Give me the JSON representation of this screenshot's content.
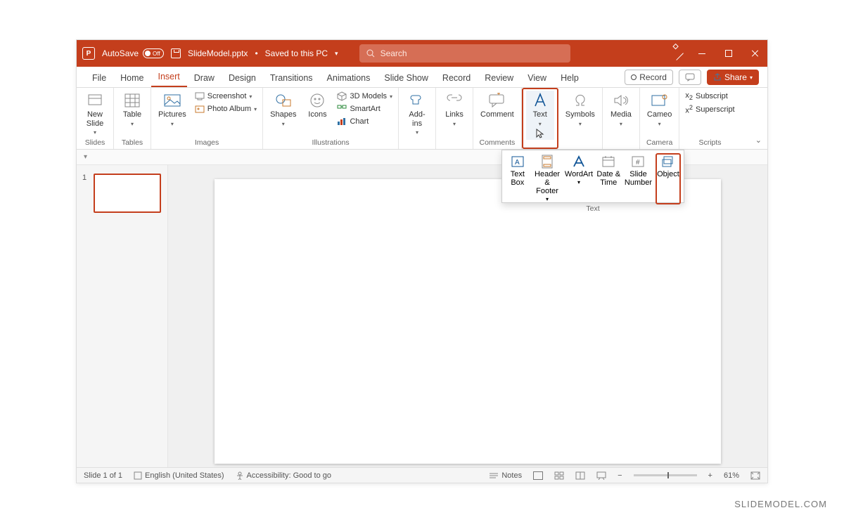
{
  "titlebar": {
    "autosave": "AutoSave",
    "autosave_state": "Off",
    "filename": "SlideModel.pptx",
    "saved_status": "Saved to this PC",
    "search_placeholder": "Search"
  },
  "tabs": {
    "file": "File",
    "home": "Home",
    "insert": "Insert",
    "draw": "Draw",
    "design": "Design",
    "transitions": "Transitions",
    "animations": "Animations",
    "slideshow": "Slide Show",
    "record": "Record",
    "review": "Review",
    "view": "View",
    "help": "Help",
    "record_btn": "Record",
    "share": "Share"
  },
  "ribbon": {
    "groups": {
      "slides": "Slides",
      "tables": "Tables",
      "images": "Images",
      "illustrations": "Illustrations",
      "comments": "Comments",
      "camera": "Camera",
      "scripts": "Scripts"
    },
    "new_slide": "New\nSlide",
    "table": "Table",
    "pictures": "Pictures",
    "screenshot": "Screenshot",
    "photo_album": "Photo Album",
    "shapes": "Shapes",
    "icons": "Icons",
    "models3d": "3D Models",
    "smartart": "SmartArt",
    "chart": "Chart",
    "addins": "Add-\nins",
    "links": "Links",
    "comment": "Comment",
    "text": "Text",
    "symbols": "Symbols",
    "media": "Media",
    "cameo": "Cameo",
    "subscript": "Subscript",
    "superscript": "Superscript"
  },
  "text_popup": {
    "group": "Text",
    "text_box": "Text\nBox",
    "header_footer": "Header\n& Footer",
    "wordart": "WordArt",
    "date_time": "Date &\nTime",
    "slide_number": "Slide\nNumber",
    "object": "Object"
  },
  "thumbs": {
    "n1": "1"
  },
  "statusbar": {
    "slide": "Slide 1 of 1",
    "lang": "English (United States)",
    "access": "Accessibility: Good to go",
    "notes": "Notes",
    "zoom": "61%"
  },
  "watermark": "SLIDEMODEL.COM"
}
